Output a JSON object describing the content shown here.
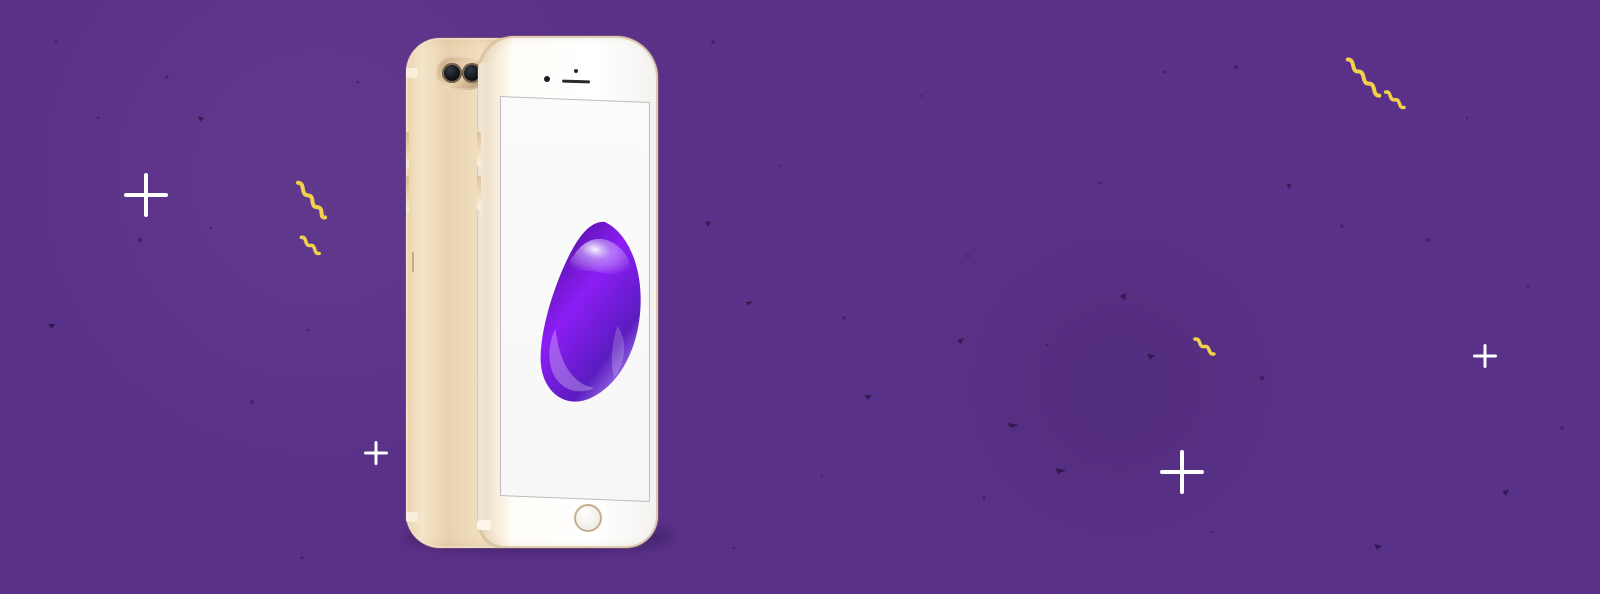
{
  "scene": {
    "background_color": "#5a3188",
    "accent_yellow": "#f2d04c",
    "icon_color": "#ffffff",
    "phone_finish_color": "#ead2aa",
    "screen_color": "#f8f8f8",
    "droplet_color": "#7b22f0"
  }
}
